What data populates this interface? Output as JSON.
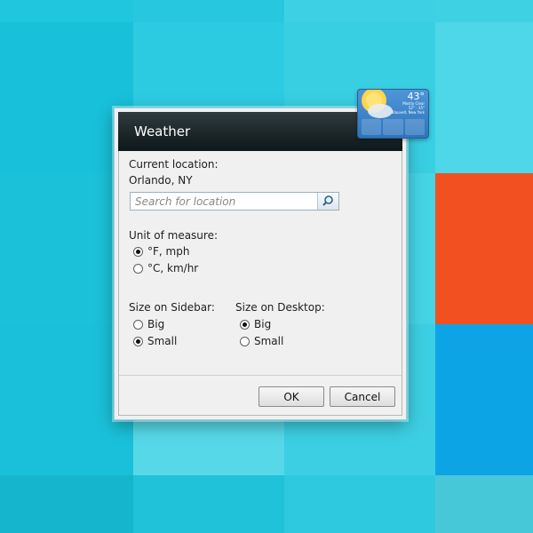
{
  "dialog": {
    "title": "Weather",
    "current_location_label": "Current location:",
    "current_location_value": "Orlando, NY",
    "search_placeholder": "Search for location",
    "unit_label": "Unit of measure:",
    "unit_options": [
      "°F, mph",
      "°C, km/hr"
    ],
    "unit_selected": "°F, mph",
    "sidebar_size_label": "Size on Sidebar:",
    "sidebar_size_options": [
      "Big",
      "Small"
    ],
    "sidebar_size_selected": "Small",
    "desktop_size_label": "Size on Desktop:",
    "desktop_size_options": [
      "Big",
      "Small"
    ],
    "desktop_size_selected": "Big",
    "ok_label": "OK",
    "cancel_label": "Cancel"
  },
  "gadget": {
    "temperature": "43°",
    "condition": "Mostly Clear",
    "range": "52° - 35°",
    "city": "Blauvelt, New York"
  },
  "icons": {
    "search": "search-icon",
    "sun": "sun-icon"
  },
  "colors": {
    "titlebar": "#1b2629",
    "desktop_orange": "#f25021",
    "desktop_blue": "#0da4e5"
  }
}
